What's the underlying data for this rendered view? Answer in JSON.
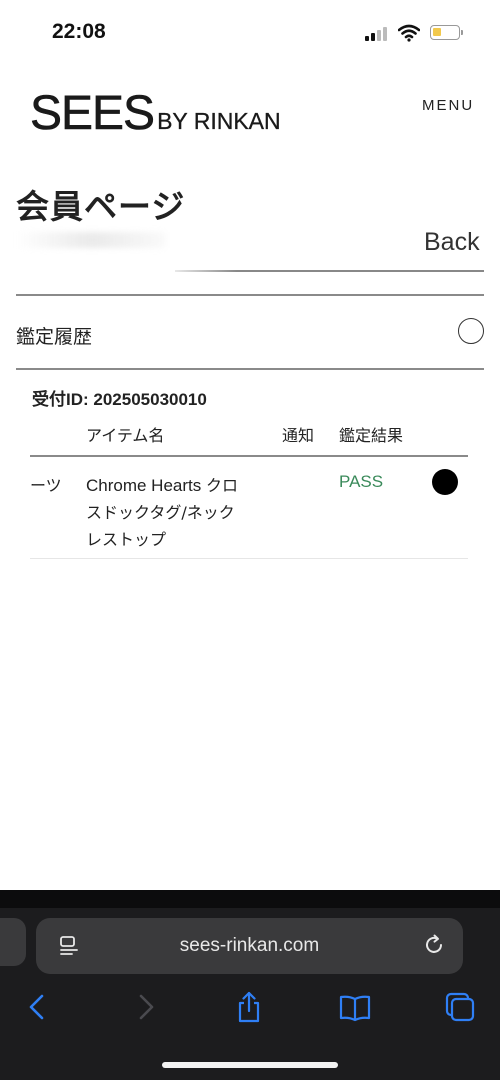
{
  "status_bar": {
    "time": "22:08"
  },
  "header": {
    "logo_main": "SEES",
    "logo_sub": "BY RINKAN",
    "menu_label": "MENU"
  },
  "page": {
    "title": "会員ページ",
    "back_label": "Back"
  },
  "section": {
    "title": "鑑定履歴"
  },
  "receipt": {
    "label": "受付ID: 202505030010"
  },
  "table": {
    "headers": {
      "item": "アイテム名",
      "notice": "通知",
      "result": "鑑定結果"
    },
    "rows": [
      {
        "category": "ーツ",
        "name_line1_en": "Chrome Hearts ",
        "name_line1_ja": "クロ",
        "name_line2": "スドックタグ/ネック",
        "name_line3": "レストップ",
        "result": "PASS"
      }
    ]
  },
  "browser": {
    "url": "sees-rinkan.com"
  },
  "colors": {
    "pass_green": "#3a8a5a",
    "safari_bg": "#1c1c1e",
    "safari_accent": "#2f7ff5",
    "battery_yellow": "#f2c94c"
  }
}
